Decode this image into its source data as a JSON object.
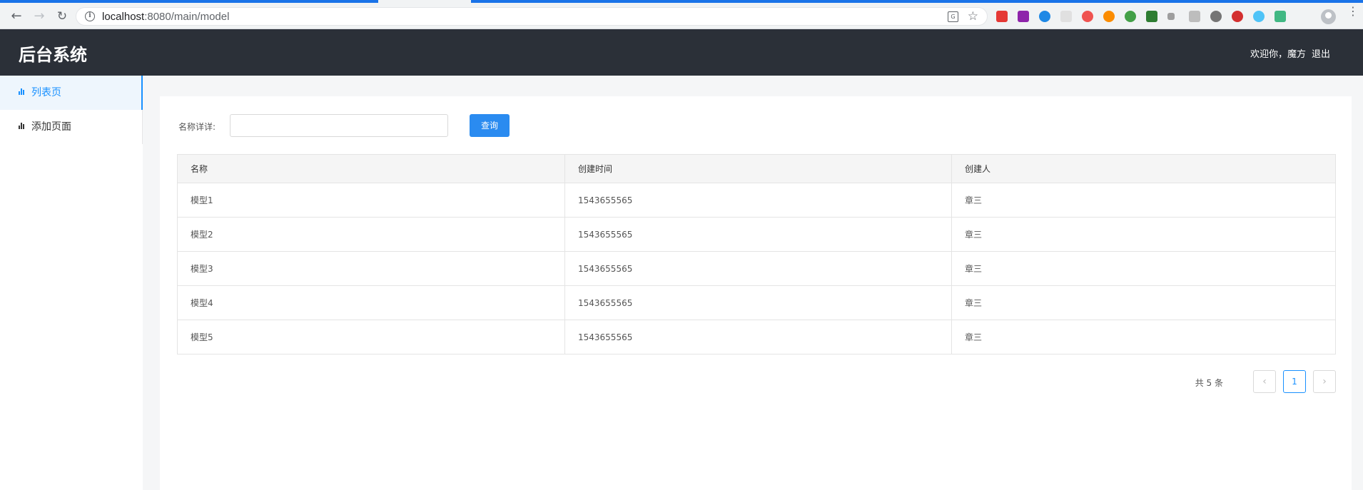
{
  "browser": {
    "url_host": "localhost",
    "url_path": ":8080/main/model"
  },
  "app": {
    "title": "后台系统",
    "welcome": "欢迎你，魔方",
    "logout": "退出"
  },
  "sidebar": {
    "items": [
      {
        "label": "列表页",
        "active": true
      },
      {
        "label": "添加页面",
        "active": false
      }
    ]
  },
  "search": {
    "label": "名称详详:",
    "value": "",
    "placeholder": "",
    "button": "查询"
  },
  "table": {
    "headers": [
      "名称",
      "创建时间",
      "创建人"
    ],
    "rows": [
      [
        "模型1",
        "1543655565",
        "章三"
      ],
      [
        "模型2",
        "1543655565",
        "章三"
      ],
      [
        "模型3",
        "1543655565",
        "章三"
      ],
      [
        "模型4",
        "1543655565",
        "章三"
      ],
      [
        "模型5",
        "1543655565",
        "章三"
      ]
    ]
  },
  "pagination": {
    "total": "共 5 条",
    "prev": "‹",
    "current": "1",
    "next": "›"
  },
  "colors": {
    "header_bg": "#2b3038",
    "accent": "#1890ff",
    "button_bg": "#2a8bf0"
  }
}
